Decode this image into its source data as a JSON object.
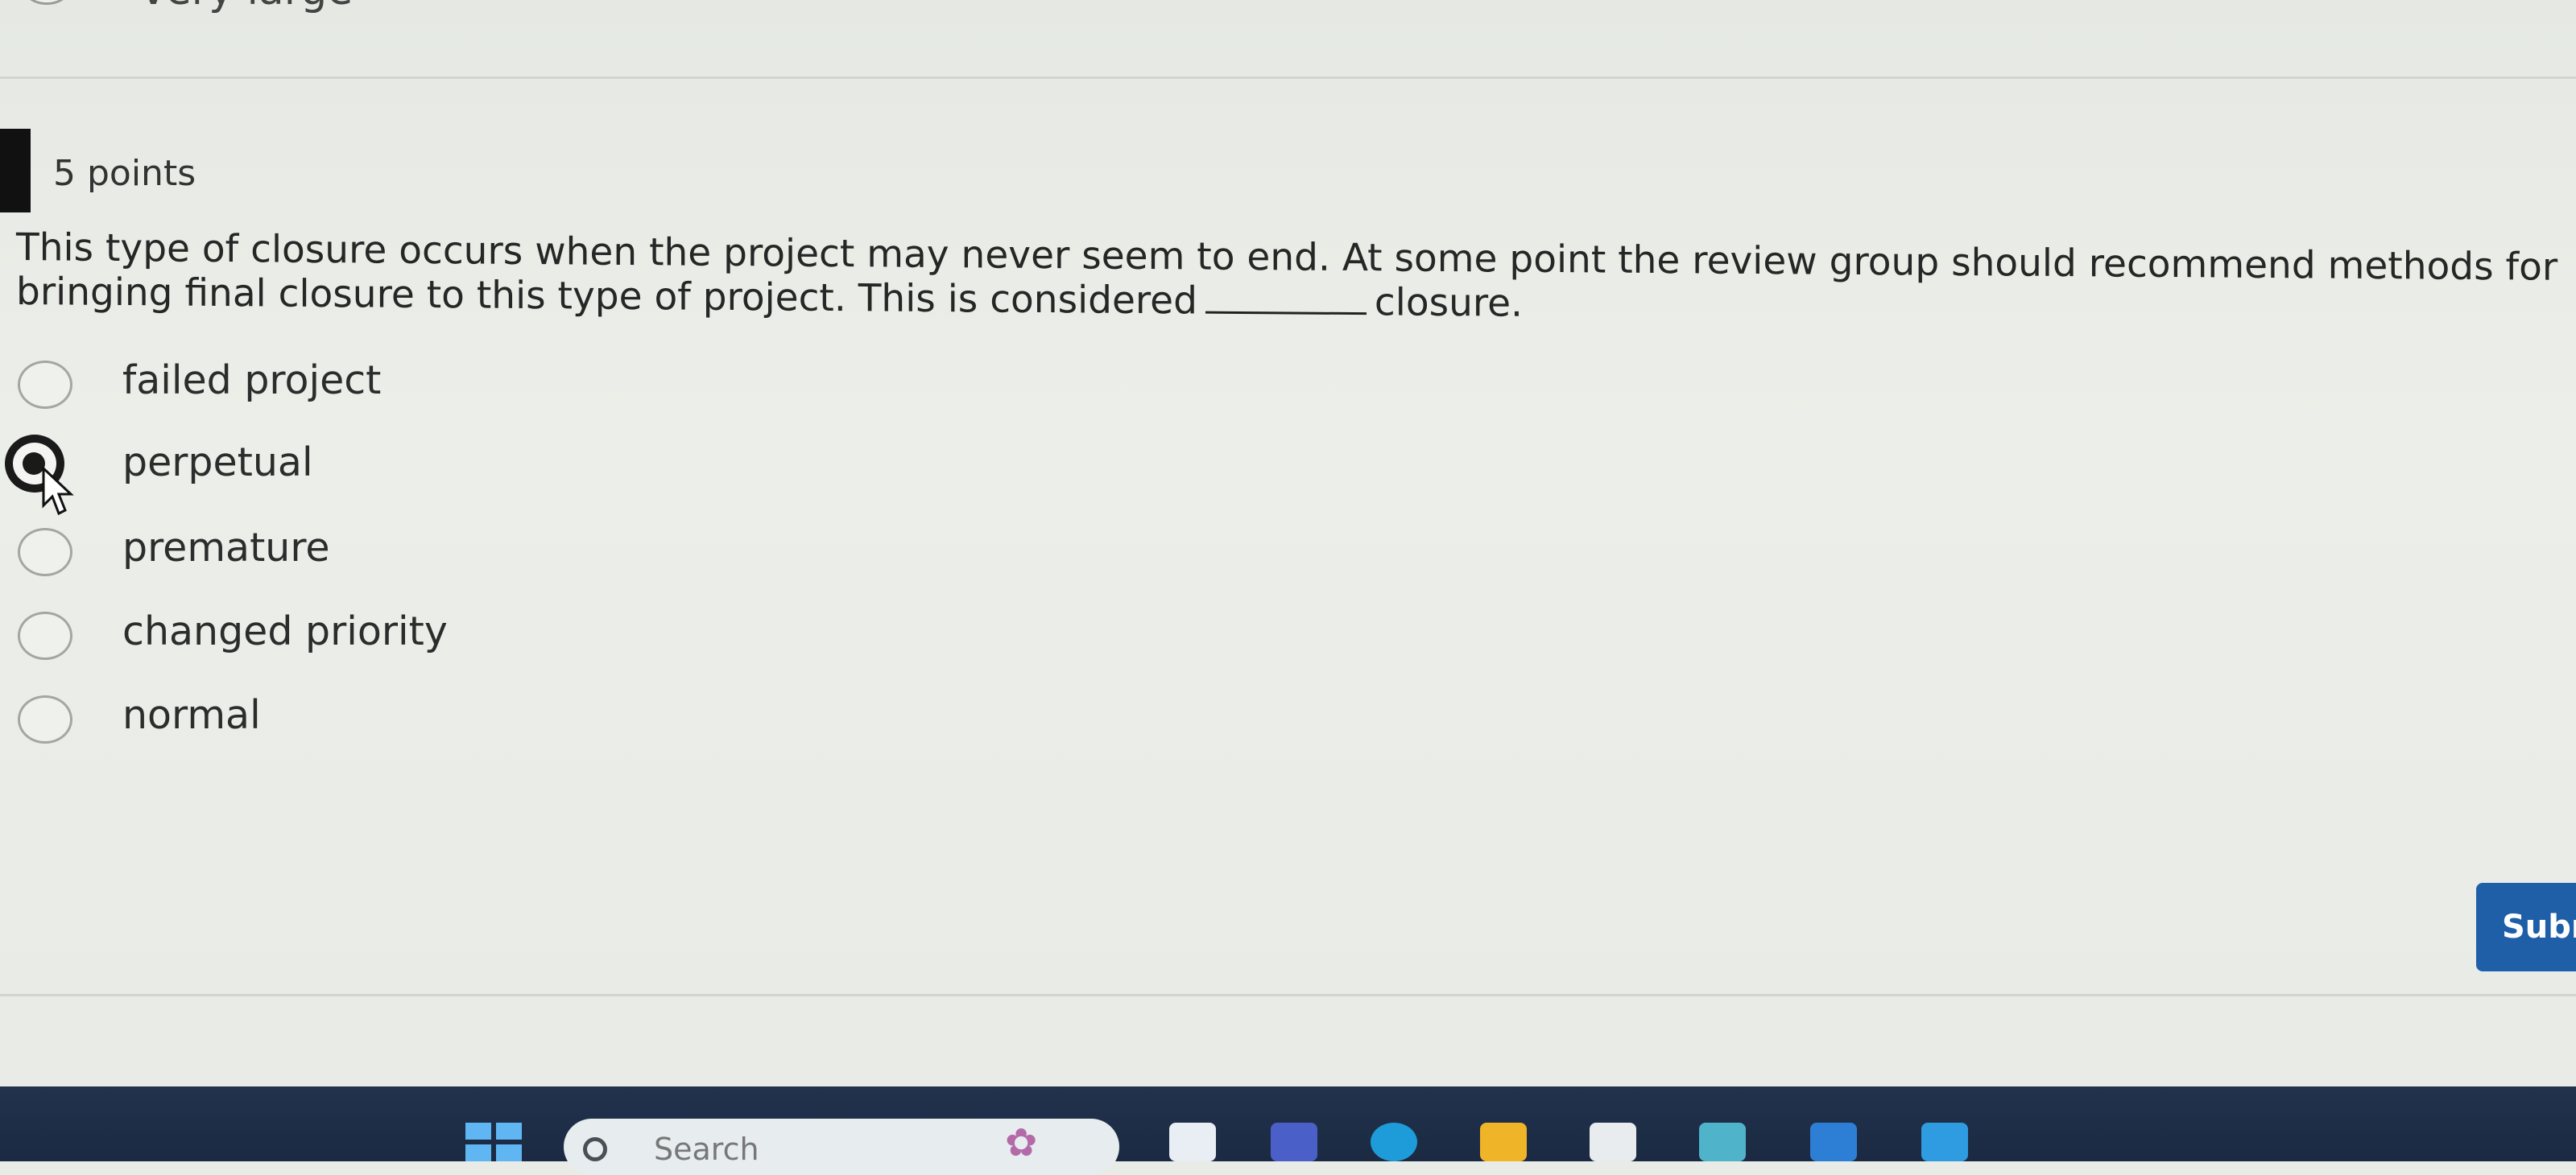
{
  "previous_question": {
    "last_option_label": "very large"
  },
  "question": {
    "points": "5 points",
    "text_before_blank": "This type of closure occurs when the project may never seem to end. At some point the review group should recommend methods for bringing final closure to this type of project. This is considered",
    "text_after_blank": "closure.",
    "options": [
      {
        "label": "failed project",
        "selected": false
      },
      {
        "label": "perpetual",
        "selected": true
      },
      {
        "label": "premature",
        "selected": false
      },
      {
        "label": "changed priority",
        "selected": false
      },
      {
        "label": "normal",
        "selected": false
      }
    ]
  },
  "actions": {
    "submit_label": "Subr"
  },
  "taskbar": {
    "search_placeholder": "Search",
    "icons": [
      "windows-start-icon",
      "search-icon",
      "widgets-flower-icon",
      "file-explorer-icon",
      "teams-icon",
      "edge-icon",
      "folder-icon",
      "amazon-icon",
      "calculator-icon",
      "mail-icon",
      "store-icon"
    ]
  },
  "colors": {
    "submit_bg": "#1f5fa8",
    "taskbar_bg": "#1b2a42",
    "page_bg": "#e9ebe6"
  }
}
